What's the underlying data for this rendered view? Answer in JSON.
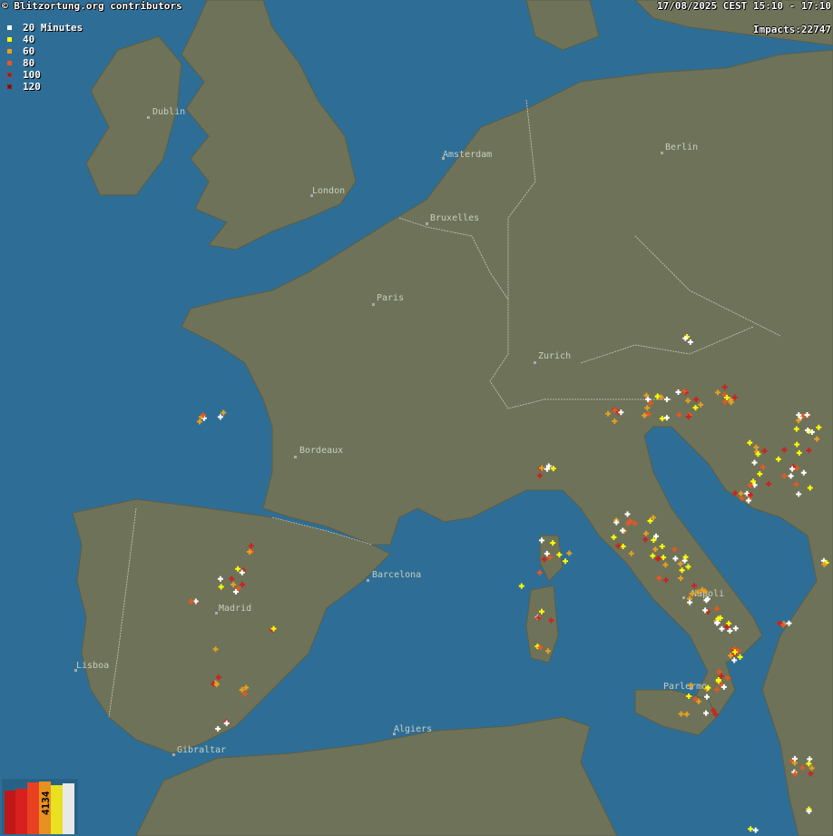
{
  "credit": "© Blitzortung.org contributors",
  "time_range": "17/08/2025 CEST 15:10 - 17:10",
  "impacts": "Impacts:22747",
  "legend": [
    {
      "label": "20 Minutes",
      "color": "#ffffff"
    },
    {
      "label": "40",
      "color": "#ffff00"
    },
    {
      "label": "60",
      "color": "#e8a020"
    },
    {
      "label": "80",
      "color": "#e85820"
    },
    {
      "label": "100",
      "color": "#d02020"
    },
    {
      "label": "120",
      "color": "#b01010"
    }
  ],
  "histogram": {
    "value": "4134",
    "bar_colors": [
      "#c01818",
      "#d82020",
      "#e84020",
      "#e89020",
      "#e8e020",
      "#f0f0f0"
    ]
  },
  "cities": [
    {
      "name": "Dublin"
    },
    {
      "name": "London"
    },
    {
      "name": "Amsterdam"
    },
    {
      "name": "Berlin"
    },
    {
      "name": "Bruxelles"
    },
    {
      "name": "Paris"
    },
    {
      "name": "Zurich"
    },
    {
      "name": "Bordeaux"
    },
    {
      "name": "Barcelona"
    },
    {
      "name": "Madrid"
    },
    {
      "name": "Lisboa"
    },
    {
      "name": "Gibraltar"
    },
    {
      "name": "Algiers"
    },
    {
      "name": "Napoli"
    },
    {
      "name": "Parlermo"
    }
  ],
  "colors": {
    "sea": "#2e6e96",
    "land": "#6e7258",
    "border": "#c8c8c8"
  }
}
